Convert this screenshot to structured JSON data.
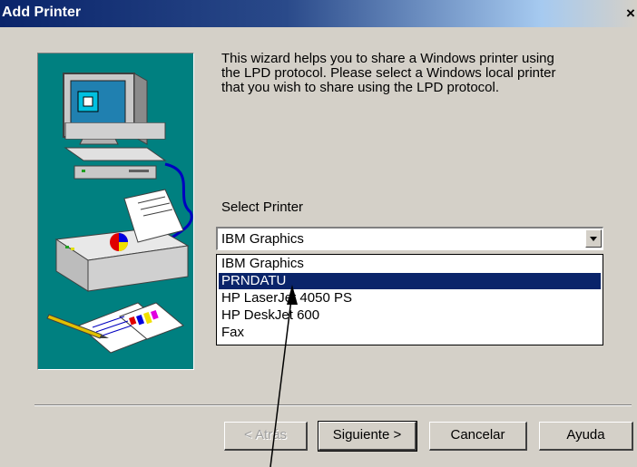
{
  "window": {
    "title": "Add Printer",
    "close_glyph": "×"
  },
  "wizard": {
    "description_lines": [
      "This wizard helps you to share a Windows printer using",
      "the LPD protocol. Please select a Windows local printer",
      "that you wish to share using the LPD protocol."
    ]
  },
  "select_printer": {
    "label": "Select Printer",
    "selected_value": "IBM Graphics",
    "options": [
      "IBM Graphics",
      "PRNDATU",
      "HP LaserJet 4050 PS",
      "HP DeskJet 600",
      "Fax"
    ],
    "highlighted_index": 1
  },
  "buttons": {
    "back": "< Atrás",
    "next": "Siguiente >",
    "cancel": "Cancelar",
    "help": "Ayuda"
  },
  "colors": {
    "title_bar": "#0a246a",
    "illustration_bg": "#008080",
    "selection": "#0a246a",
    "dialog_bg": "#d4d0c8"
  }
}
